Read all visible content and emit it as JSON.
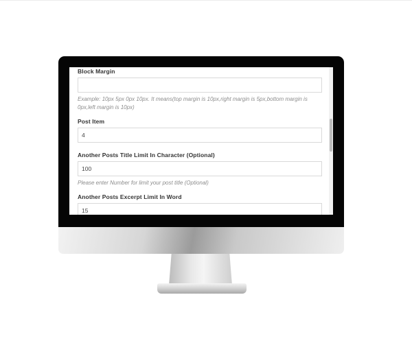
{
  "form": {
    "block_margin": {
      "label": "Block Margin",
      "value": "",
      "help": "Example: 10px 5px 0px 10px. It means(top margin is 10px,right margin is 5px,bottom margin is 0px,left margin is 10px)"
    },
    "post_item": {
      "label": "Post Item",
      "value": "4"
    },
    "title_limit": {
      "label": "Another Posts Title Limit In Character (Optional)",
      "value": "100",
      "help": "Please enter Number for limit your post title (Optional)"
    },
    "excerpt_limit": {
      "label": "Another Posts Excerpt Limit In Word",
      "value": "15"
    }
  },
  "colors": {
    "bezel": "#050505",
    "label_text": "#333333",
    "help_text": "#8c8c8c",
    "input_border": "#d9d9d9"
  }
}
